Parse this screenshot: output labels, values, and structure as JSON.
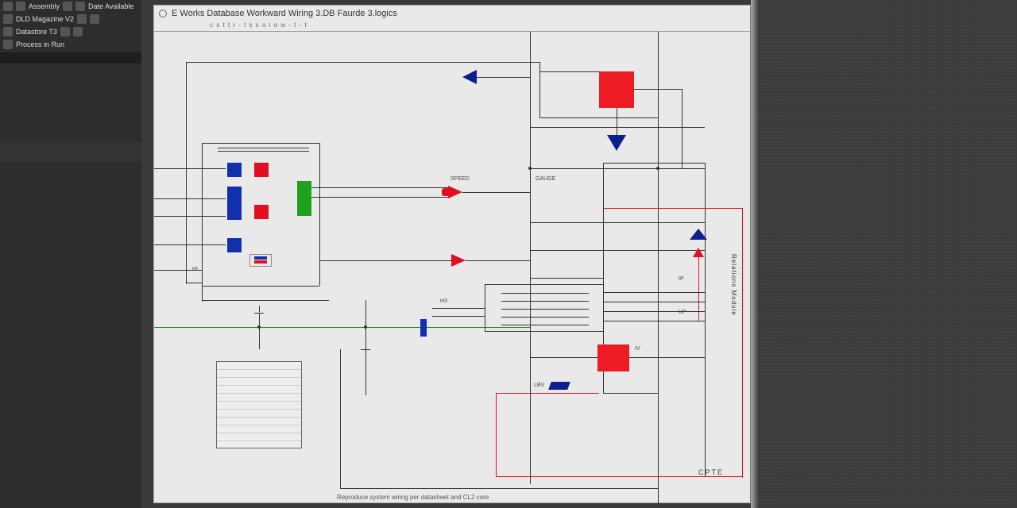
{
  "sidebar": {
    "rows": [
      {
        "label": "Assembly",
        "extra": "Date Available"
      },
      {
        "label": "DLD Magazine V2"
      },
      {
        "label": "Datastore  T3"
      },
      {
        "label": "Process in Run"
      }
    ]
  },
  "window": {
    "title": "E Works Database Workward Wiring 3.DB  Faurde 3.logics",
    "subtitle": "c s   t  t  r  -   t  s  s  o  i  o  w  -   t  -  t"
  },
  "diagram": {
    "labels": {
      "input_a": "SPEED",
      "input_b": "GAUGE",
      "right_side": "Relations  Module",
      "bottom_right_tag": "CPTE",
      "small_tag1": "LBV",
      "mid_tag_l": "HI",
      "mid_tag_r": "H3",
      "port1": "IP",
      "port2": "UP",
      "port3": "IV"
    },
    "notes_label": "",
    "footer": "Reproduce system wiring per datasheet and CL2 core"
  },
  "colors": {
    "red": "#ed1c24",
    "blue": "#0b1f8f",
    "green": "#1fa01f",
    "wire_red": "#e01020",
    "wire_green": "#0a9010"
  }
}
